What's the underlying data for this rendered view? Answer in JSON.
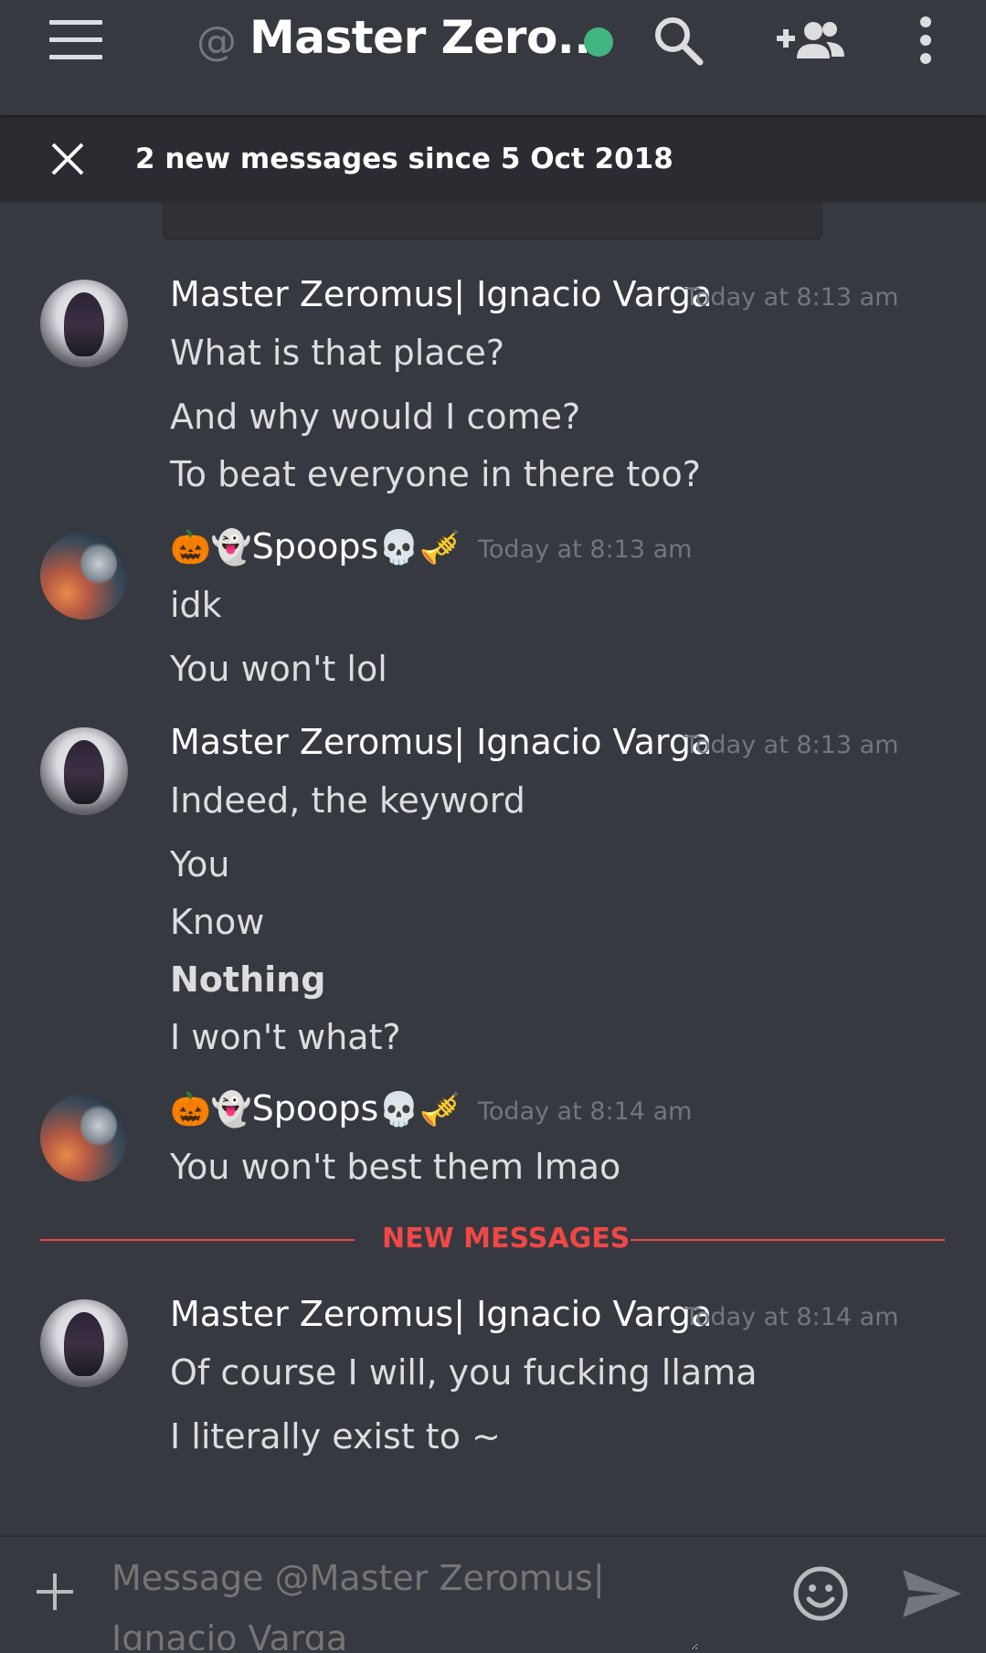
{
  "header": {
    "at_symbol": "@",
    "title": "Master Zero...",
    "status_color": "#43b581",
    "icons": [
      "menu-icon",
      "search-icon",
      "add-friend-icon",
      "more-vertical-icon"
    ]
  },
  "banner": {
    "text": "2 new messages since 5 Oct 2018"
  },
  "messages": [
    {
      "author": "Master Zeromus| Ignacio Varga",
      "time": "Today at 8:13 am",
      "lines": [
        "What is that place?",
        "And why would I come?",
        "To beat everyone in there too?"
      ]
    },
    {
      "author_prefix": "🎃👻",
      "author": "Spoops",
      "author_suffix": "💀🎺",
      "time": "Today at 8:13 am",
      "lines": [
        "idk",
        "You won't lol"
      ]
    },
    {
      "author": "Master Zeromus| Ignacio Varga",
      "time": "Today at 8:13 am",
      "lines": [
        "Indeed, the keyword",
        "You",
        "Know",
        "Nothing",
        "I won't what?"
      ]
    },
    {
      "author_prefix": "🎃👻",
      "author": "Spoops",
      "author_suffix": "💀🎺",
      "time": "Today at 8:14 am",
      "lines": [
        "You won't best them lmao"
      ]
    },
    {
      "author": "Master Zeromus| Ignacio Varga",
      "time": "Today at 8:14 am",
      "lines": [
        "Of course I will, you fucking llama",
        "I literally exist to ~"
      ]
    }
  ],
  "divider": {
    "label": "NEW MESSAGES",
    "color": "#f04747"
  },
  "composer": {
    "placeholder": "Message @Master Zeromus| Ignacio Varga"
  }
}
